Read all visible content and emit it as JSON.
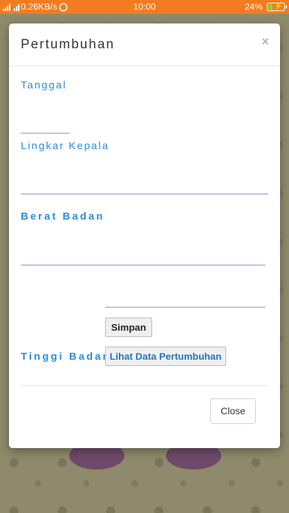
{
  "status_bar": {
    "network_speed": "0.26KB/s",
    "time": "10:00",
    "battery_percent": "24%",
    "battery_level": 0.24
  },
  "modal": {
    "title": "Pertumbuhan",
    "close_icon": "×",
    "fields": {
      "tanggal": "Tanggal",
      "lingkar_kepala": "Lingkar Kepala",
      "berat_badan": "Berat Badan",
      "tinggi_badan": "Tinggi Badan"
    },
    "buttons": {
      "simpan": "Simpan",
      "lihat_data": "Lihat Data Pertumbuhan",
      "close": "Close"
    }
  },
  "colors": {
    "status_bar": "#f37c20",
    "label_blue": "#2a8fd6",
    "input_line": "#cdb9e6"
  }
}
